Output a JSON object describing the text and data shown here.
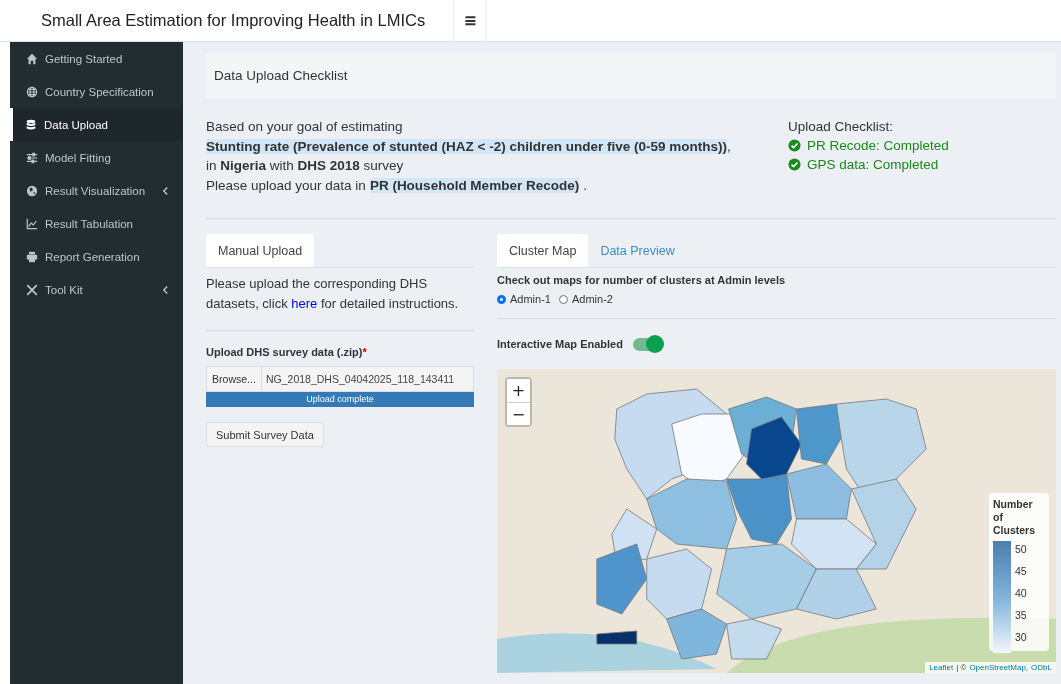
{
  "header": {
    "title": "Small Area Estimation for Improving Health in LMICs",
    "menu_icon": "≡"
  },
  "sidebar": {
    "items": [
      {
        "label": "Getting Started",
        "selected": false,
        "expandable": false
      },
      {
        "label": "Country Specification",
        "selected": false,
        "expandable": false
      },
      {
        "label": "Data Upload",
        "selected": true,
        "expandable": false
      },
      {
        "label": "Model Fitting",
        "selected": false,
        "expandable": false
      },
      {
        "label": "Result Visualization",
        "selected": false,
        "expandable": true
      },
      {
        "label": "Result Tabulation",
        "selected": false,
        "expandable": false
      },
      {
        "label": "Report Generation",
        "selected": false,
        "expandable": false
      },
      {
        "label": "Tool Kit",
        "selected": false,
        "expandable": true
      }
    ]
  },
  "checklist_header": "Data Upload Checklist",
  "goal": {
    "line1": "Based on your goal of estimating",
    "indicator": "Stunting rate (Prevalence of stunted (HAZ < -2) children under five (0-59 months))",
    "indicator_suffix": ",",
    "line3": "in **Nigeria** with **DHS 2018** survey",
    "line4_prefix": "Please upload your data in",
    "recode": "PR (Household Member Recode)",
    "line4_suffix": "."
  },
  "upload_checklist": {
    "title": "Upload Checklist:",
    "items": [
      {
        "label": "PR Recode: Completed",
        "completed": true
      },
      {
        "label": "GPS data: Completed",
        "completed": true
      }
    ]
  },
  "left_tabs": [
    {
      "label": "Manual Upload",
      "selected": true
    }
  ],
  "instructions": {
    "before": "Please upload the corresponding DHS datasets, click",
    "link": "here",
    "after": "for detailed instructions."
  },
  "upload": {
    "label": "Upload DHS survey data (.zip)",
    "required_mark": "*",
    "browse": "Browse...",
    "filename": "NG_2018_DHS_04042025_118_143411",
    "progress_text": "Upload complete",
    "level": 1
  },
  "submit_button": "Submit Survey Data",
  "right_tabs": [
    {
      "label": "Cluster Map",
      "selected": true
    },
    {
      "label": "Data Preview",
      "selected": false
    }
  ],
  "admin_prompt": "Check out maps for number of clusters at Admin levels",
  "admin_options": [
    {
      "label": "Admin-1",
      "selected": true
    },
    {
      "label": "Admin-2",
      "selected": false
    }
  ],
  "interactive_toggle": {
    "label": "Interactive Map Enabled",
    "on": true
  },
  "map": {
    "zoom_in": "+",
    "zoom_out": "−",
    "legend_title": "Number of Clusters",
    "legend_ticks": [
      "50",
      "45",
      "40",
      "35",
      "30"
    ],
    "attribution": {
      "leaflet": "Leaflet",
      "separator": "| ©",
      "osm": "OpenStreetMap,",
      "odbl": "ODbL"
    }
  }
}
